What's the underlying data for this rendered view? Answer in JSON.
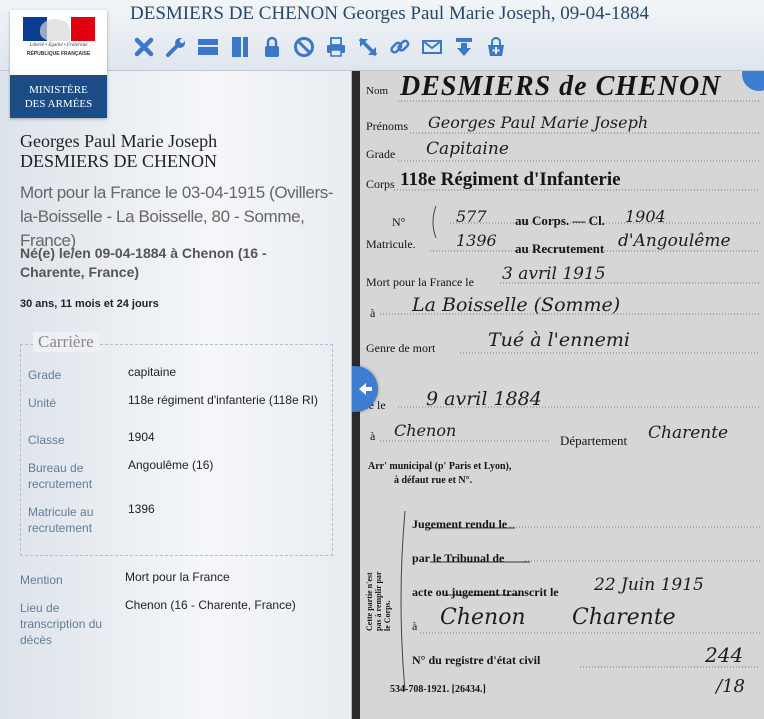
{
  "header": {
    "title": "DESMIERS DE CHENON Georges Paul Marie Joseph, 09-04-1884",
    "toolbar": [
      "close-icon",
      "wrench-icon",
      "horizontal-layout-icon",
      "vertical-layout-icon",
      "lock-icon",
      "forbidden-icon",
      "print-icon",
      "resize-icon",
      "link-icon",
      "mail-icon",
      "download-icon",
      "add-cart-icon"
    ]
  },
  "logo": {
    "motto": "Liberté • Égalité • Fraternité",
    "republic": "RÉPUBLIQUE FRANÇAISE",
    "ministry_line1": "MINISTÈRE",
    "ministry_line2": "DES ARMÉES",
    "flag_colors": [
      "#0a3d91",
      "#ffffff",
      "#e1000f"
    ]
  },
  "person": {
    "first_names": "Georges Paul Marie Joseph",
    "last_name": "DESMIERS DE CHENON",
    "death": "Mort pour la France le 03-04-1915 (Ovillers-la-Boisselle - La Boisselle, 80 - Somme, France)",
    "birth": "Né(e) le/en 09-04-1884 à Chenon (16 - Charente, France)",
    "age": "30 ans, 11 mois et 24 jours"
  },
  "career": {
    "legend": "Carrière",
    "rows": [
      {
        "label": "Grade",
        "value": "capitaine"
      },
      {
        "label": "Unité",
        "value": "118e régiment d'infanterie (118e RI)"
      },
      {
        "label": "Classe",
        "value": "1904"
      },
      {
        "label": "Bureau de recrutement",
        "value": "Angoulême (16)"
      },
      {
        "label": "Matricule au recrutement",
        "value": "1396"
      }
    ]
  },
  "extra": [
    {
      "label": "Mention",
      "value": "Mort pour la France"
    },
    {
      "label": "Lieu de transcription du décès",
      "value": "Chenon (16 - Charente, France)"
    }
  ],
  "document": {
    "nom_label": "Nom",
    "nom_value": "DESMIERS de CHENON",
    "prenoms_label": "Prénoms",
    "prenoms_value": "Georges Paul Marie Joseph",
    "grade_label": "Grade",
    "grade_value": "Capitaine",
    "corps_label": "Corps",
    "corps_value": "118e Régiment d'Infanterie",
    "no_label": "N°",
    "no_value": "577",
    "au_corps": "au Corps. — Cl.",
    "classe_value": "1904",
    "matricule_label": "Matricule.",
    "matricule_value": "1396",
    "au_recrutement": "au Recrutement",
    "recrutement_value": "d'Angoulême",
    "mort_label": "Mort pour la France le",
    "mort_value": "3 avril 1915",
    "a_label": "à",
    "a_value": "La Boisselle (Somme)",
    "genre_label": "Genre de mort",
    "genre_value": "Tué à l'ennemi",
    "ne_label": "Né le",
    "ne_value": "9 avril 1884",
    "a2_label": "à",
    "a2_value": "Chenon",
    "departement_label": "Département",
    "departement_value": "Charente",
    "arr_line1": "Arr' municipal (p' Paris et Lyon),",
    "arr_line2": "à défaut rue et N°.",
    "jugement_line": "Jugement rendu le",
    "tribunal_line": "par le Tribunal de",
    "acte_line": "acte ou jugement transcrit le",
    "transcrit_value": "22 Juin 1915",
    "a3_label": "à",
    "a3_value": "Chenon",
    "a3_dept": "Charente",
    "registre_line": "N° du registre d'état civil",
    "registre_value": "244",
    "side_note": "Cette partie n'est pas à remplir par le Corps.",
    "printer": "534-708-1921. [26434.]",
    "page_mark": "/18"
  }
}
